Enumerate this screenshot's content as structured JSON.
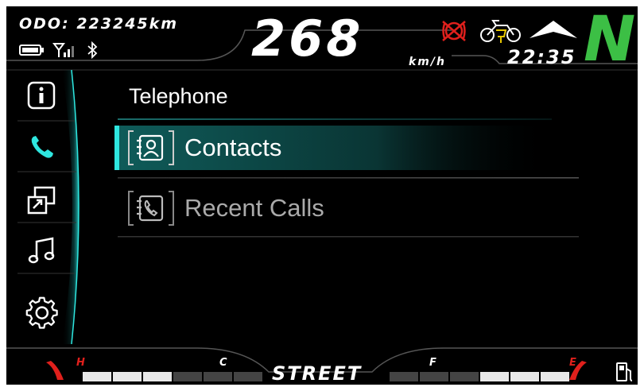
{
  "header": {
    "odo_label": "ODO:",
    "odo_value": "223245km",
    "speed": "268",
    "speed_unit": "km/h",
    "time": "22:35",
    "gear": "N"
  },
  "status_icons": [
    "battery-icon",
    "signal-icon",
    "bluetooth-icon"
  ],
  "warning_icons": [
    "abs-off-icon",
    "motorcycle-key-icon",
    "up-shift-icon"
  ],
  "sidebar": {
    "items": [
      {
        "icon": "info-icon",
        "active": false
      },
      {
        "icon": "phone-icon",
        "active": true
      },
      {
        "icon": "screen-mirror-icon",
        "active": false
      },
      {
        "icon": "music-icon",
        "active": false
      },
      {
        "icon": "gear-settings-icon",
        "active": false
      }
    ]
  },
  "menu": {
    "title": "Telephone",
    "items": [
      {
        "label": "Contacts",
        "icon": "contacts-icon",
        "selected": true
      },
      {
        "label": "Recent Calls",
        "icon": "recent-calls-icon",
        "selected": false
      }
    ]
  },
  "footer": {
    "mode": "STREET",
    "temp_gauge": {
      "high_label": "H",
      "low_label": "C",
      "level": 0.5
    },
    "fuel_gauge": {
      "full_label": "F",
      "empty_label": "E",
      "level": 0.5
    }
  },
  "colors": {
    "accent": "#2ee6df",
    "gear": "#3cbf45",
    "warning": "#e0201c",
    "yellow": "#e8c800"
  }
}
